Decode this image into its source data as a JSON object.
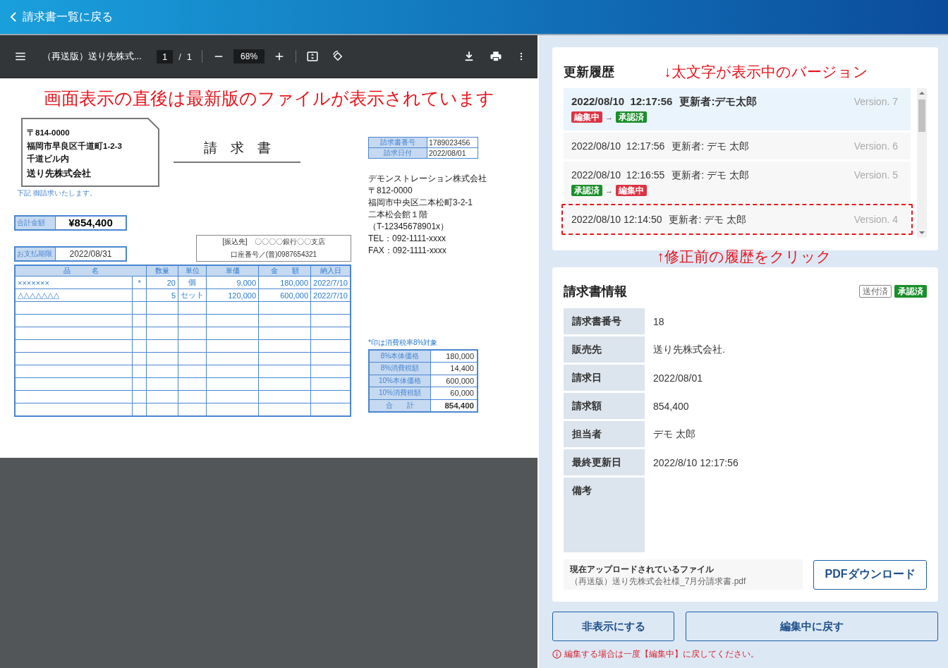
{
  "header": {
    "back_label": "請求書一覧に戻る"
  },
  "pdf_viewer": {
    "file_title": "（再送版）送り先株式...",
    "page": "1",
    "page_separator": "/",
    "page_total": "1",
    "zoom": "68%",
    "annotation": "画面表示の直後は最新版のファイルが表示されています",
    "document": {
      "recipient": {
        "lines": [
          "〒814-0000",
          "福岡市早良区千道町1-2-3",
          "千道ビル内"
        ],
        "name": "送り先株式会社"
      },
      "title": "請　求　書",
      "note": "下記 御請求いたします。",
      "total": {
        "label": "合計金額",
        "value": "¥854,400"
      },
      "due": {
        "label": "お支払期限",
        "value": "2022/08/31"
      },
      "bank": {
        "lines": [
          "[振込先]　〇〇〇〇銀行〇〇支店",
          "口座番号／(普)0987654321"
        ]
      },
      "columns": [
        "品　　　名",
        "数量",
        "単位",
        "単価",
        "金　　額",
        "納入日"
      ],
      "rows": [
        {
          "name": "×××××××",
          "tax_mark": "*",
          "qty": "20",
          "unit": "個",
          "price": "9,000",
          "amount": "180,000",
          "date": "2022/7/10"
        },
        {
          "name": "△△△△△△△",
          "qty": "5",
          "unit": "セット",
          "price": "120,000",
          "amount": "600,000",
          "date": "2022/7/10"
        }
      ],
      "meta": [
        {
          "label": "請求書番号",
          "value": "1789023456"
        },
        {
          "label": "請求日付",
          "value": "2022/08/01"
        }
      ],
      "sender": [
        "デモンストレーション株式会社",
        "〒812-0000",
        "福岡市中央区二本松町3-2-1",
        "二本松会館１階",
        "（T-12345678901x）",
        "TEL：092-1111-xxxx",
        "FAX：092-1111-xxxx"
      ],
      "tax_note": "*印は消費税率8%対象",
      "summary": [
        {
          "label": "8%本体価格",
          "value": "180,000",
          "kind": "line"
        },
        {
          "label": "8%消費税額",
          "value": "14,400",
          "kind": "line"
        },
        {
          "label": "10%本体価格",
          "value": "600,000",
          "kind": "line"
        },
        {
          "label": "10%消費税額",
          "value": "60,000",
          "kind": "line"
        },
        {
          "label": "合　　計",
          "value": "854,400",
          "kind": "total"
        }
      ]
    }
  },
  "update_history": {
    "title": "更新履歴",
    "annotation": "↓太文字が表示中のバージョン",
    "entries": [
      {
        "datetime": "2022/08/10  12:17:56",
        "updater": "更新者:デモ太郎",
        "version": "Version. 7",
        "selected": true,
        "highlighted": false,
        "transition": {
          "from": {
            "label": "編集中",
            "color": "#dc3545"
          },
          "arrow": "→",
          "to": {
            "label": "承認済",
            "color": "#1a8f2a"
          }
        }
      },
      {
        "datetime": "2022/08/10  12:17:56",
        "updater": "更新者: デモ 太郎",
        "version": "Version. 6",
        "selected": false,
        "highlighted": false
      },
      {
        "datetime": "2022/08/10  12:16:55",
        "updater": "更新者: デモ 太郎",
        "version": "Version. 5",
        "selected": false,
        "highlighted": false,
        "transition": {
          "from": {
            "label": "承認済",
            "color": "#1a8f2a"
          },
          "arrow": "→",
          "to": {
            "label": "編集中",
            "color": "#dc3545"
          }
        }
      },
      {
        "datetime": "2022/08/10 12:14:50",
        "updater": "更新者: デモ 太郎",
        "version": "Version. 4",
        "selected": false,
        "highlighted": true
      }
    ],
    "click_annotation": "↑修正前の履歴をクリック"
  },
  "invoice_info": {
    "title": "請求書情報",
    "badges": [
      {
        "label": "送付済",
        "kind": "outline"
      },
      {
        "label": "承認済",
        "kind": "filled",
        "color": "#1a8f2a"
      }
    ],
    "fields": [
      {
        "label": "請求書番号",
        "value": "18",
        "kind": "text"
      },
      {
        "label": "販売先",
        "value": "送り先株式会社.",
        "kind": "text"
      },
      {
        "label": "請求日",
        "value": "2022/08/01",
        "kind": "text"
      },
      {
        "label": "請求額",
        "value": "854,400",
        "kind": "text"
      },
      {
        "label": "担当者",
        "value": "デモ 太郎",
        "kind": "text"
      },
      {
        "label": "最終更新日",
        "value": "2022/8/10 12:17:56",
        "kind": "text"
      },
      {
        "label": "備考",
        "kind": "notes"
      }
    ],
    "file": {
      "caption": "現在アップロードされているファイル",
      "name": "（再送版）送り先株式会社様_7月分請求書.pdf"
    },
    "download_button": "PDFダウンロード"
  },
  "actions": [
    "非表示にする",
    "編集中に戻す"
  ],
  "warning": "編集する場合は一度【編集中】に戻してください。"
}
